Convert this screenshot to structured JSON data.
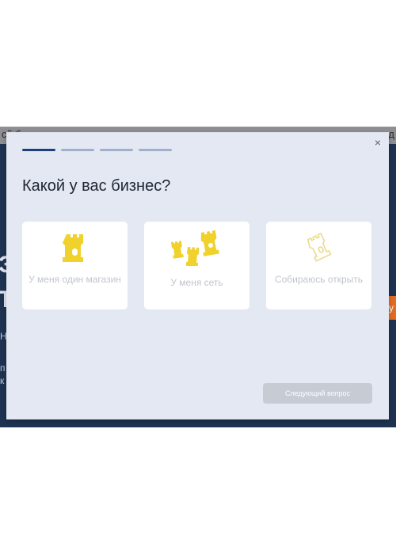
{
  "background": {
    "strip_left": "сй б",
    "strip_right": "д",
    "fragments": [
      "Э",
      "T",
      "Н",
      "п",
      "к"
    ],
    "orange_button_fragment": "у"
  },
  "modal": {
    "close_symbol": "×",
    "progress": {
      "total_steps": 4,
      "current_step": 1
    },
    "title": "Какой у вас бизнес?",
    "options": [
      {
        "label": "У меня один магазин",
        "icon": "single-tower-icon"
      },
      {
        "label": "У меня сеть",
        "icon": "multiple-towers-icon"
      },
      {
        "label": "Собираюсь открыть",
        "icon": "tower-outline-icon"
      }
    ],
    "next_button": "Следующий вопрос"
  },
  "colors": {
    "accent": "#1f3f7a",
    "icon_yellow": "#f1d12b",
    "icon_yellow_faded": "#ecdb8b",
    "modal_bg": "#e3e8f2"
  }
}
